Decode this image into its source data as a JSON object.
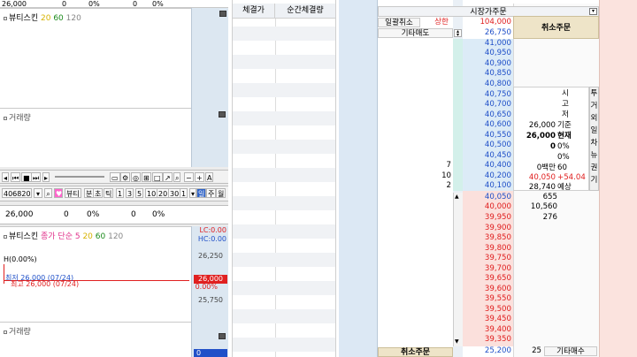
{
  "left_panel": {
    "top_strip": {
      "price": "26,000",
      "qty": "0",
      "pct": "0%",
      "qty2": "0",
      "pct2": "0%"
    },
    "chart1": {
      "legend_name": "뷰티스킨",
      "legend_vals": [
        "20",
        "60",
        "120"
      ]
    },
    "volume1_label": "거래량",
    "toolbar": {
      "code": "406820",
      "tab_beauty": "뷰티",
      "tab_min": "분",
      "tab_tick": "초",
      "tab_t": "틱",
      "periods": [
        "1",
        "3",
        "5",
        "10",
        "20",
        "30",
        "1"
      ],
      "day": "일",
      "week": "주",
      "month": "월"
    },
    "quote_row": {
      "price": "26,000",
      "qty": "0",
      "pct": "0%",
      "qty2": "0",
      "pct2": "0%"
    },
    "chart2": {
      "legend_name": "뷰티스킨",
      "legend_type": "종가 단순 5",
      "legend_vals": [
        "20",
        "60",
        "120"
      ],
      "lc": "LC:0.00",
      "hc": "HC:0.00",
      "h_marker": "H(0.00%)",
      "mark_high": "최저 26,000 (07/24)",
      "mark_low": "최고 26,000 (07/24)",
      "ticks": [
        "26,250",
        "26,000",
        "25,750"
      ],
      "current_price": "26,000",
      "current_pct": "0.00%"
    },
    "volume2_label": "거래량",
    "volume2_axis": "0"
  },
  "middle_panel": {
    "headers": [
      "체결가",
      "순간체결량"
    ]
  },
  "order_panel": {
    "title": "시장가주문",
    "btn_cancel_all": "일괄취소",
    "label_upper": "상한",
    "upper_price": "104,000",
    "btn_other_sell": "기타매도",
    "other_sell_price": "26,750",
    "cancel_header": "취소주문",
    "ask_prices": [
      "41,000",
      "40,950",
      "40,900",
      "40,850",
      "40,800",
      "40,750",
      "40,700",
      "40,650",
      "40,600",
      "40,550",
      "40,500",
      "40,450",
      "40,400",
      "40,200",
      "40,100"
    ],
    "ask_qty": {
      "40,400": "7",
      "40,200": "10",
      "40,100": "2"
    },
    "bid_prices": [
      "40,050",
      "40,000",
      "39,950",
      "39,900",
      "39,850",
      "39,800",
      "39,750",
      "39,700",
      "39,650",
      "39,600",
      "39,550",
      "39,500",
      "39,450",
      "39,400",
      "39,350"
    ],
    "bid_qty": {
      "40,050": "655",
      "40,000": "10,560",
      "39,950": "276"
    },
    "info": {
      "open_label": "시",
      "high_label": "고",
      "low_label": "저",
      "base_value": "26,000",
      "base_label": "기준",
      "current_value": "26,000",
      "current_label": "현재",
      "change1": "0",
      "change1_unit": "0%",
      "change2": "0%",
      "trade_value": "0백만",
      "trade_value2": "60",
      "expected_price": "40,050",
      "expected_change": "+54.04",
      "expected_qty": "28,740",
      "expected_label": "예상"
    },
    "side_tabs": [
      "투",
      "거",
      "외",
      "일",
      "차",
      "뉴",
      "권",
      "기"
    ],
    "footer": {
      "cancel_order": "취소주문",
      "price": "25,200",
      "qty": "25",
      "other_buy": "기타매수"
    }
  }
}
